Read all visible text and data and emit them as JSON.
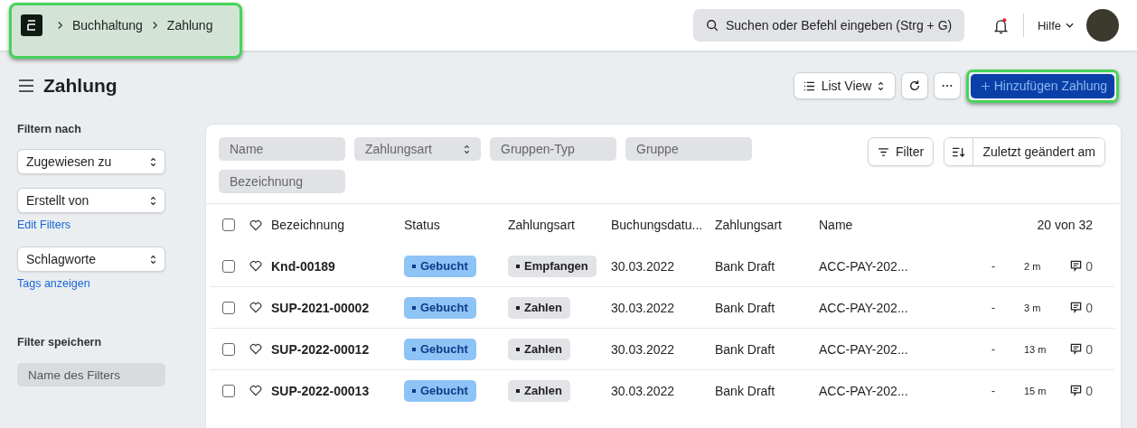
{
  "topbar": {
    "breadcrumbs": [
      "Buchhaltung",
      "Zahlung"
    ],
    "breadcrumbs_highlighted": true,
    "search": {
      "placeholder": "Suchen oder Befehl eingeben (Strg + G)"
    },
    "notifications_unread": true,
    "help": "Hilfe"
  },
  "page": {
    "title": "Zahlung",
    "view_select": "List View",
    "add_button": "Hinzufügen Zahlung",
    "add_highlighted": true
  },
  "sidebar": {
    "heading": "Filtern nach",
    "selects": [
      "Zugewiesen zu",
      "Erstellt von"
    ],
    "edit_filters": "Edit Filters",
    "tags_select": "Schlagworte",
    "show_tags": "Tags anzeigen",
    "save_heading": "Filter speichern",
    "save_field": {
      "placeholder": "Name des Filters"
    }
  },
  "filters": [
    {
      "kind": "text",
      "placeholder": "Name"
    },
    {
      "kind": "select",
      "placeholder": "Zahlungsart"
    },
    {
      "kind": "text",
      "placeholder": "Gruppen-Typ"
    },
    {
      "kind": "text",
      "placeholder": "Gruppe"
    },
    {
      "kind": "text",
      "placeholder": "Bezeichnung"
    }
  ],
  "filter_button": "Filter",
  "sort_button": "Zuletzt geändert am",
  "table": {
    "columns": [
      "Bezeichnung",
      "Status",
      "Zahlungsart",
      "Buchungsdatu...",
      "Zahlungsart",
      "Name"
    ],
    "count": "20 von 32",
    "header_checked": false,
    "header_liked": false,
    "rows": [
      {
        "id": "Knd-00189",
        "status": "Gebucht",
        "type": "Empfangen",
        "date": "30.03.2022",
        "mode": "Bank Draft",
        "name": "ACC-PAY-202...",
        "column_7": "-",
        "modified": "2 m",
        "comments": "0",
        "checked": false,
        "liked": false
      },
      {
        "id": "SUP-2021-00002",
        "status": "Gebucht",
        "type": "Zahlen",
        "date": "30.03.2022",
        "mode": "Bank Draft",
        "name": "ACC-PAY-202...",
        "column_7": "-",
        "modified": "3 m",
        "comments": "0",
        "checked": false,
        "liked": false
      },
      {
        "id": "SUP-2022-00012",
        "status": "Gebucht",
        "type": "Zahlen",
        "date": "30.03.2022",
        "mode": "Bank Draft",
        "name": "ACC-PAY-202...",
        "column_7": "-",
        "modified": "13 m",
        "comments": "0",
        "checked": false,
        "liked": false
      },
      {
        "id": "SUP-2022-00013",
        "status": "Gebucht",
        "type": "Zahlen",
        "date": "30.03.2022",
        "mode": "Bank Draft",
        "name": "ACC-PAY-202...",
        "column_7": "-",
        "modified": "15 m",
        "comments": "0",
        "checked": false,
        "liked": false
      }
    ]
  }
}
